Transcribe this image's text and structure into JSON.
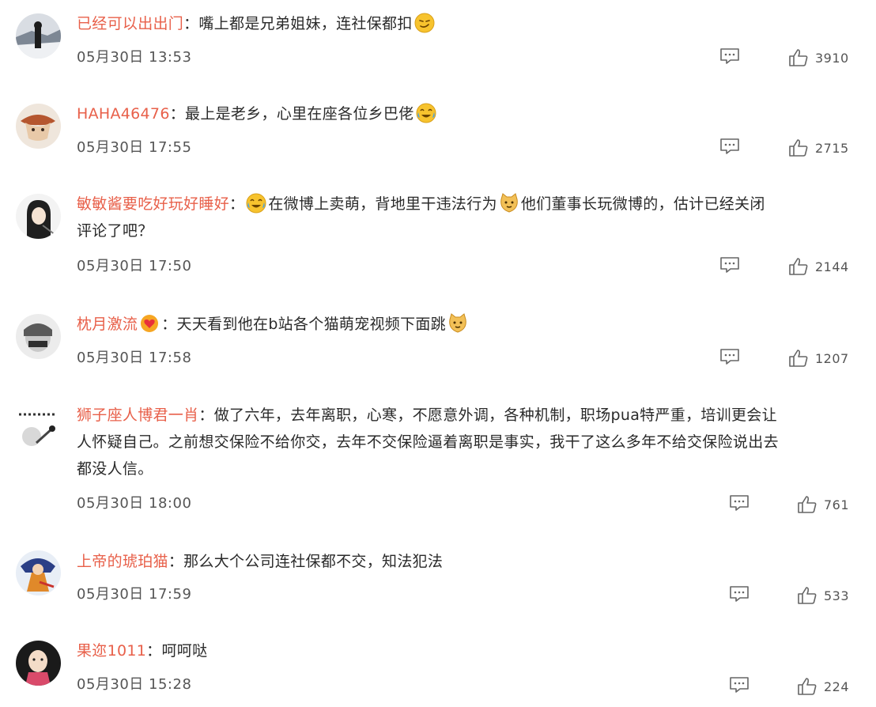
{
  "comments": [
    {
      "username": "已经可以出出门",
      "sep": "：",
      "text_a": "嘴上都是兄弟姐妹，连社保都扣",
      "emoji_a": "smirk-emoji",
      "time": "05月30日 13:53",
      "likes": "3910"
    },
    {
      "username": "HAHA46476",
      "sep": "：",
      "text_a": "最上是老乡，心里在座各位乡巴佬",
      "emoji_a": "laugh-cry-emoji",
      "time": "05月30日 17:55",
      "likes": "2715"
    },
    {
      "username": "敏敏酱要吃好玩好睡好",
      "sep": "：",
      "emoji_a": "laugh-cry-emoji",
      "text_a": "在微博上卖萌，背地里干违法行为",
      "emoji_b": "doge-emoji",
      "text_b": "他们董事长玩微博的，估计已经关闭",
      "text_c": "评论了吧？",
      "time": "05月30日 17:50",
      "likes": "2144"
    },
    {
      "username": "枕月激流",
      "badge": "heart-badge-icon",
      "sep": "：",
      "text_a": "天天看到他在b站各个猫萌宠视频下面跳",
      "emoji_a": "doge-emoji",
      "time": "05月30日 17:58",
      "likes": "1207"
    },
    {
      "username": "狮子座人博君一肖",
      "sep": "：",
      "text_a": "做了六年，去年离职，心寒，不愿意外调，各种机制，职场pua特严重，培训更会让",
      "text_b": "人怀疑自己。之前想交保险不给你交，去年不交保险逼着离职是事实，我干了这么多年不给交保险说出去",
      "text_c": "都没人信。",
      "time": "05月30日 18:00",
      "likes": "761"
    },
    {
      "username": "上帝的琥珀猫",
      "sep": "：",
      "text_a": "那么大个公司连社保都不交，知法犯法",
      "time": "05月30日 17:59",
      "likes": "533"
    },
    {
      "username": "果迩1011",
      "sep": "：",
      "text_a": "呵呵哒",
      "time": "05月30日 15:28",
      "likes": "224"
    }
  ],
  "colors": {
    "username": "#e8604a",
    "text": "#2a2a2a",
    "meta": "#555555",
    "emoji": "#f7c32e"
  }
}
